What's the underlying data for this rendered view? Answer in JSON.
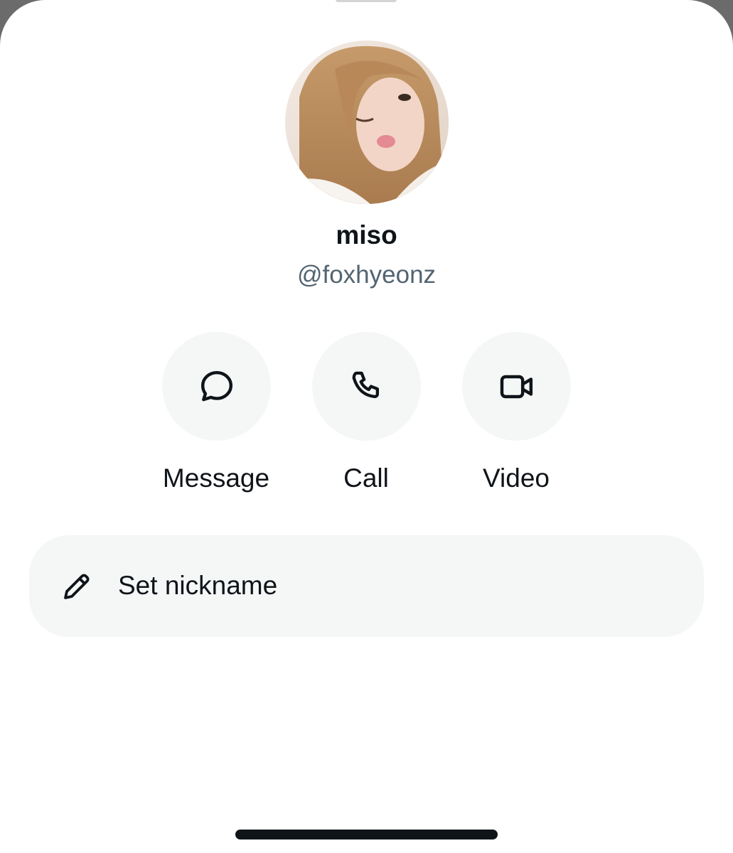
{
  "profile": {
    "display_name": "miso",
    "handle": "@foxhyeonz"
  },
  "actions": [
    {
      "label": "Message",
      "icon": "chat-bubble-icon"
    },
    {
      "label": "Call",
      "icon": "phone-icon"
    },
    {
      "label": "Video",
      "icon": "video-camera-icon"
    }
  ],
  "nickname": {
    "label": "Set nickname",
    "icon": "pencil-icon"
  },
  "colors": {
    "text_primary": "#0f1419",
    "text_secondary": "#536471",
    "button_bg": "#f5f6f6",
    "sheet_bg": "#ffffff"
  }
}
